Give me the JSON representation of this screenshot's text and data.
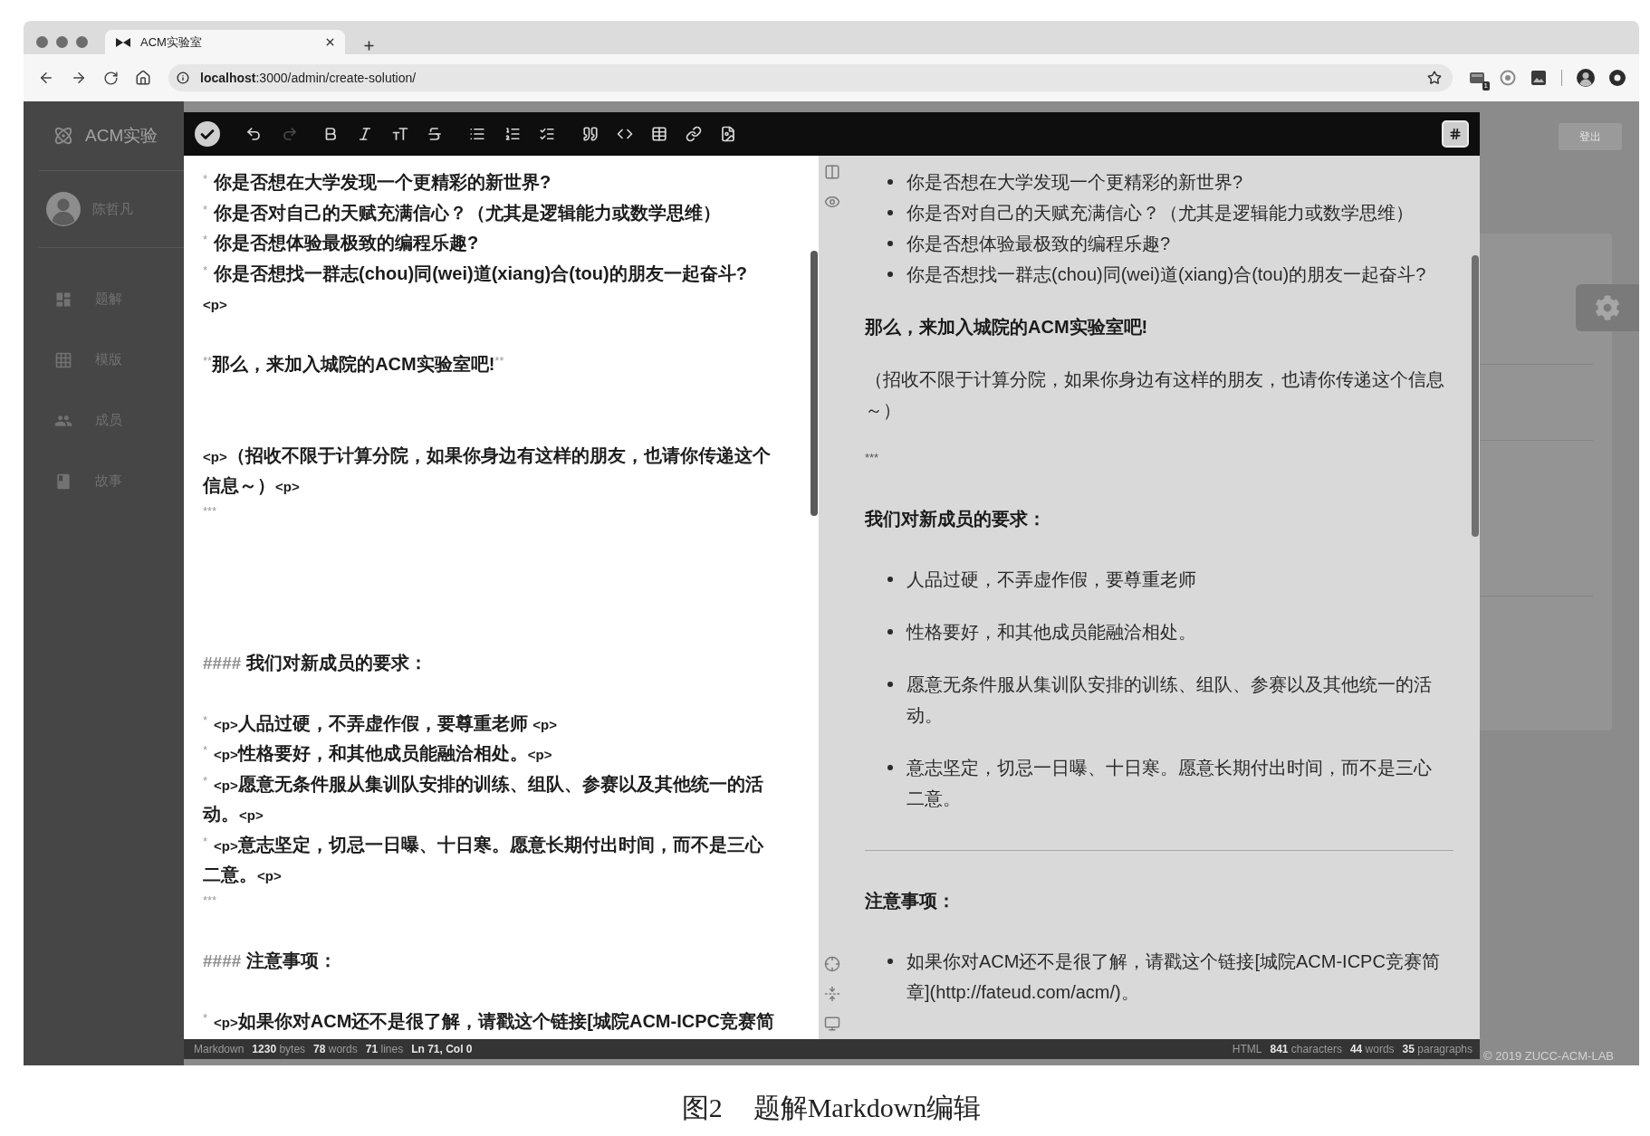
{
  "browser": {
    "tab": {
      "title": "ACM实验室"
    },
    "address": "**localhost**:3000/admin/create-solution/",
    "badge": "1"
  },
  "sidebar": {
    "brand": "ACM实验",
    "user": "陈哲凡",
    "items": [
      "题解",
      "模版",
      "成员",
      "故事"
    ]
  },
  "header": {
    "logout": "登出"
  },
  "editor": {
    "toolbar": [
      {
        "kind": "confirm",
        "disabled": false
      },
      {
        "kind": "undo",
        "disabled": false
      },
      {
        "kind": "redo",
        "disabled": true
      },
      {
        "kind": "bold",
        "disabled": false
      },
      {
        "kind": "italic",
        "disabled": false
      },
      {
        "kind": "heading",
        "disabled": false
      },
      {
        "kind": "strike",
        "disabled": false
      },
      {
        "kind": "bullets",
        "disabled": false
      },
      {
        "kind": "numbers",
        "disabled": false
      },
      {
        "kind": "tasks",
        "disabled": false
      },
      {
        "kind": "quote",
        "disabled": false
      },
      {
        "kind": "code",
        "disabled": false
      },
      {
        "kind": "table",
        "disabled": false
      },
      {
        "kind": "link",
        "disabled": false
      },
      {
        "kind": "image",
        "disabled": false
      }
    ],
    "source": [
      {
        "kind": "text",
        "segments": [
          {
            "kind": "bullet",
            "text": "*"
          },
          {
            "kind": "text",
            "text": "你是否想在大学发现一个更精彩的新世界?"
          }
        ]
      },
      {
        "kind": "text",
        "segments": [
          {
            "kind": "bullet",
            "text": "*"
          },
          {
            "kind": "text",
            "text": "你是否对自己的天赋充满信心？（尤其是逻辑能力或数学思维）"
          }
        ]
      },
      {
        "kind": "text",
        "segments": [
          {
            "kind": "bullet",
            "text": "*"
          },
          {
            "kind": "text",
            "text": "你是否想体验最极致的编程乐趣?"
          }
        ]
      },
      {
        "kind": "text",
        "segments": [
          {
            "kind": "bullet",
            "text": "*"
          },
          {
            "kind": "text",
            "text": "你是否想找一群志(chou)同(wei)道(xiang)合(tou)的朋友一起奋斗?"
          }
        ]
      },
      {
        "kind": "text",
        "segments": [
          {
            "kind": "tag",
            "text": "<p>"
          }
        ]
      },
      {
        "kind": "blank"
      },
      {
        "kind": "text",
        "segments": [
          {
            "kind": "stars",
            "text": "**"
          },
          {
            "kind": "strong",
            "text": "那么，来加入城院的ACM实验室吧!"
          },
          {
            "kind": "stars",
            "text": "**"
          }
        ]
      },
      {
        "kind": "blank"
      },
      {
        "kind": "blank"
      },
      {
        "kind": "text",
        "segments": [
          {
            "kind": "tag",
            "text": "<p>"
          },
          {
            "kind": "text",
            "text": "（招收不限于计算分院，如果你身边有这样的朋友，也请你传递这个信息～）"
          },
          {
            "kind": "tag",
            "text": "<p>"
          }
        ]
      },
      {
        "kind": "rule",
        "segments": [
          {
            "kind": "stars",
            "text": "***"
          }
        ]
      },
      {
        "kind": "blank"
      },
      {
        "kind": "blank"
      },
      {
        "kind": "blank"
      },
      {
        "kind": "blank"
      },
      {
        "kind": "text",
        "segments": [
          {
            "kind": "hashes",
            "text": "####"
          },
          {
            "kind": "strong",
            "text": "我们对新成员的要求："
          }
        ]
      },
      {
        "kind": "blank"
      },
      {
        "kind": "text",
        "segments": [
          {
            "kind": "bullet",
            "text": "*"
          },
          {
            "kind": "tag",
            "text": "<p>"
          },
          {
            "kind": "text",
            "text": "人品过硬，不弄虚作假，要尊重老师 "
          },
          {
            "kind": "tag",
            "text": "<p>"
          }
        ]
      },
      {
        "kind": "text",
        "segments": [
          {
            "kind": "bullet",
            "text": "*"
          },
          {
            "kind": "tag",
            "text": "<p>"
          },
          {
            "kind": "text",
            "text": "性格要好，和其他成员能融洽相处。"
          },
          {
            "kind": "tag",
            "text": "<p>"
          }
        ]
      },
      {
        "kind": "text",
        "segments": [
          {
            "kind": "bullet",
            "text": "*"
          },
          {
            "kind": "tag",
            "text": "<p>"
          },
          {
            "kind": "text",
            "text": "愿意无条件服从集训队安排的训练、组队、参赛以及其他统一的活动。"
          },
          {
            "kind": "tag",
            "text": "<p>"
          }
        ]
      },
      {
        "kind": "text",
        "segments": [
          {
            "kind": "bullet",
            "text": "*"
          },
          {
            "kind": "tag",
            "text": "<p>"
          },
          {
            "kind": "text",
            "text": "意志坚定，切忌一日曝、十日寒。愿意长期付出时间，而不是三心二意。"
          },
          {
            "kind": "tag",
            "text": "<p>"
          }
        ]
      },
      {
        "kind": "rule",
        "segments": [
          {
            "kind": "stars",
            "text": "***"
          }
        ]
      },
      {
        "kind": "blank"
      },
      {
        "kind": "text",
        "segments": [
          {
            "kind": "hashes",
            "text": "####"
          },
          {
            "kind": "strong",
            "text": "注意事项："
          }
        ]
      },
      {
        "kind": "blank"
      },
      {
        "kind": "text",
        "segments": [
          {
            "kind": "bullet",
            "text": "*"
          },
          {
            "kind": "tag",
            "text": "<p>"
          },
          {
            "kind": "text",
            "text": "如果你对ACM还不是很了解，请戳这个链接[城院ACM-ICPC竞赛简"
          }
        ]
      }
    ],
    "preview": [
      {
        "kind": "list",
        "items": [
          "你是否想在大学发现一个更精彩的新世界?",
          "你是否对自己的天赋充满信心？（尤其是逻辑能力或数学思维）",
          "你是否想体验最极致的编程乐趣?",
          "你是否想找一群志(chou)同(wei)道(xiang)合(tou)的朋友一起奋斗?"
        ]
      },
      {
        "kind": "paragraph",
        "bold": true,
        "text": "那么，来加入城院的ACM实验室吧!"
      },
      {
        "kind": "paragraph",
        "bold": false,
        "text": "（招收不限于计算分院，如果你身边有这样的朋友，也请你传递这个信息～）"
      },
      {
        "kind": "stars",
        "text": "***"
      },
      {
        "kind": "heading",
        "text": "我们对新成员的要求："
      },
      {
        "kind": "loose_list",
        "items": [
          "人品过硬，不弄虚作假，要尊重老师",
          "性格要好，和其他成员能融洽相处。",
          "愿意无条件服从集训队安排的训练、组队、参赛以及其他统一的活动。",
          "意志坚定，切忌一日曝、十日寒。愿意长期付出时间，而不是三心二意。"
        ]
      },
      {
        "kind": "rule"
      },
      {
        "kind": "heading",
        "text": "注意事项："
      },
      {
        "kind": "loose_list",
        "items": [
          "如果你对ACM还不是很了解，请戳这个链接[城院ACM-ICPC竞赛简章](http://fateud.com/acm/)。"
        ]
      }
    ],
    "status_left": [
      {
        "kind": "mode",
        "text": "Markdown"
      },
      {
        "kind": "count",
        "text": "**1230** bytes"
      },
      {
        "kind": "count",
        "text": "**78** words"
      },
      {
        "kind": "count",
        "text": "**71** lines"
      },
      {
        "kind": "cursor",
        "text": "Ln 71, Col 0"
      }
    ],
    "status_right": [
      {
        "kind": "mode",
        "text": "HTML"
      },
      {
        "kind": "count",
        "text": "**841** characters"
      },
      {
        "kind": "count",
        "text": "**44** words"
      },
      {
        "kind": "count",
        "text": "**35** paragraphs"
      }
    ]
  },
  "footer": "© 2019 ZUCC-ACM-LAB",
  "caption": {
    "label": "图2",
    "title": "题解Markdown编辑"
  }
}
